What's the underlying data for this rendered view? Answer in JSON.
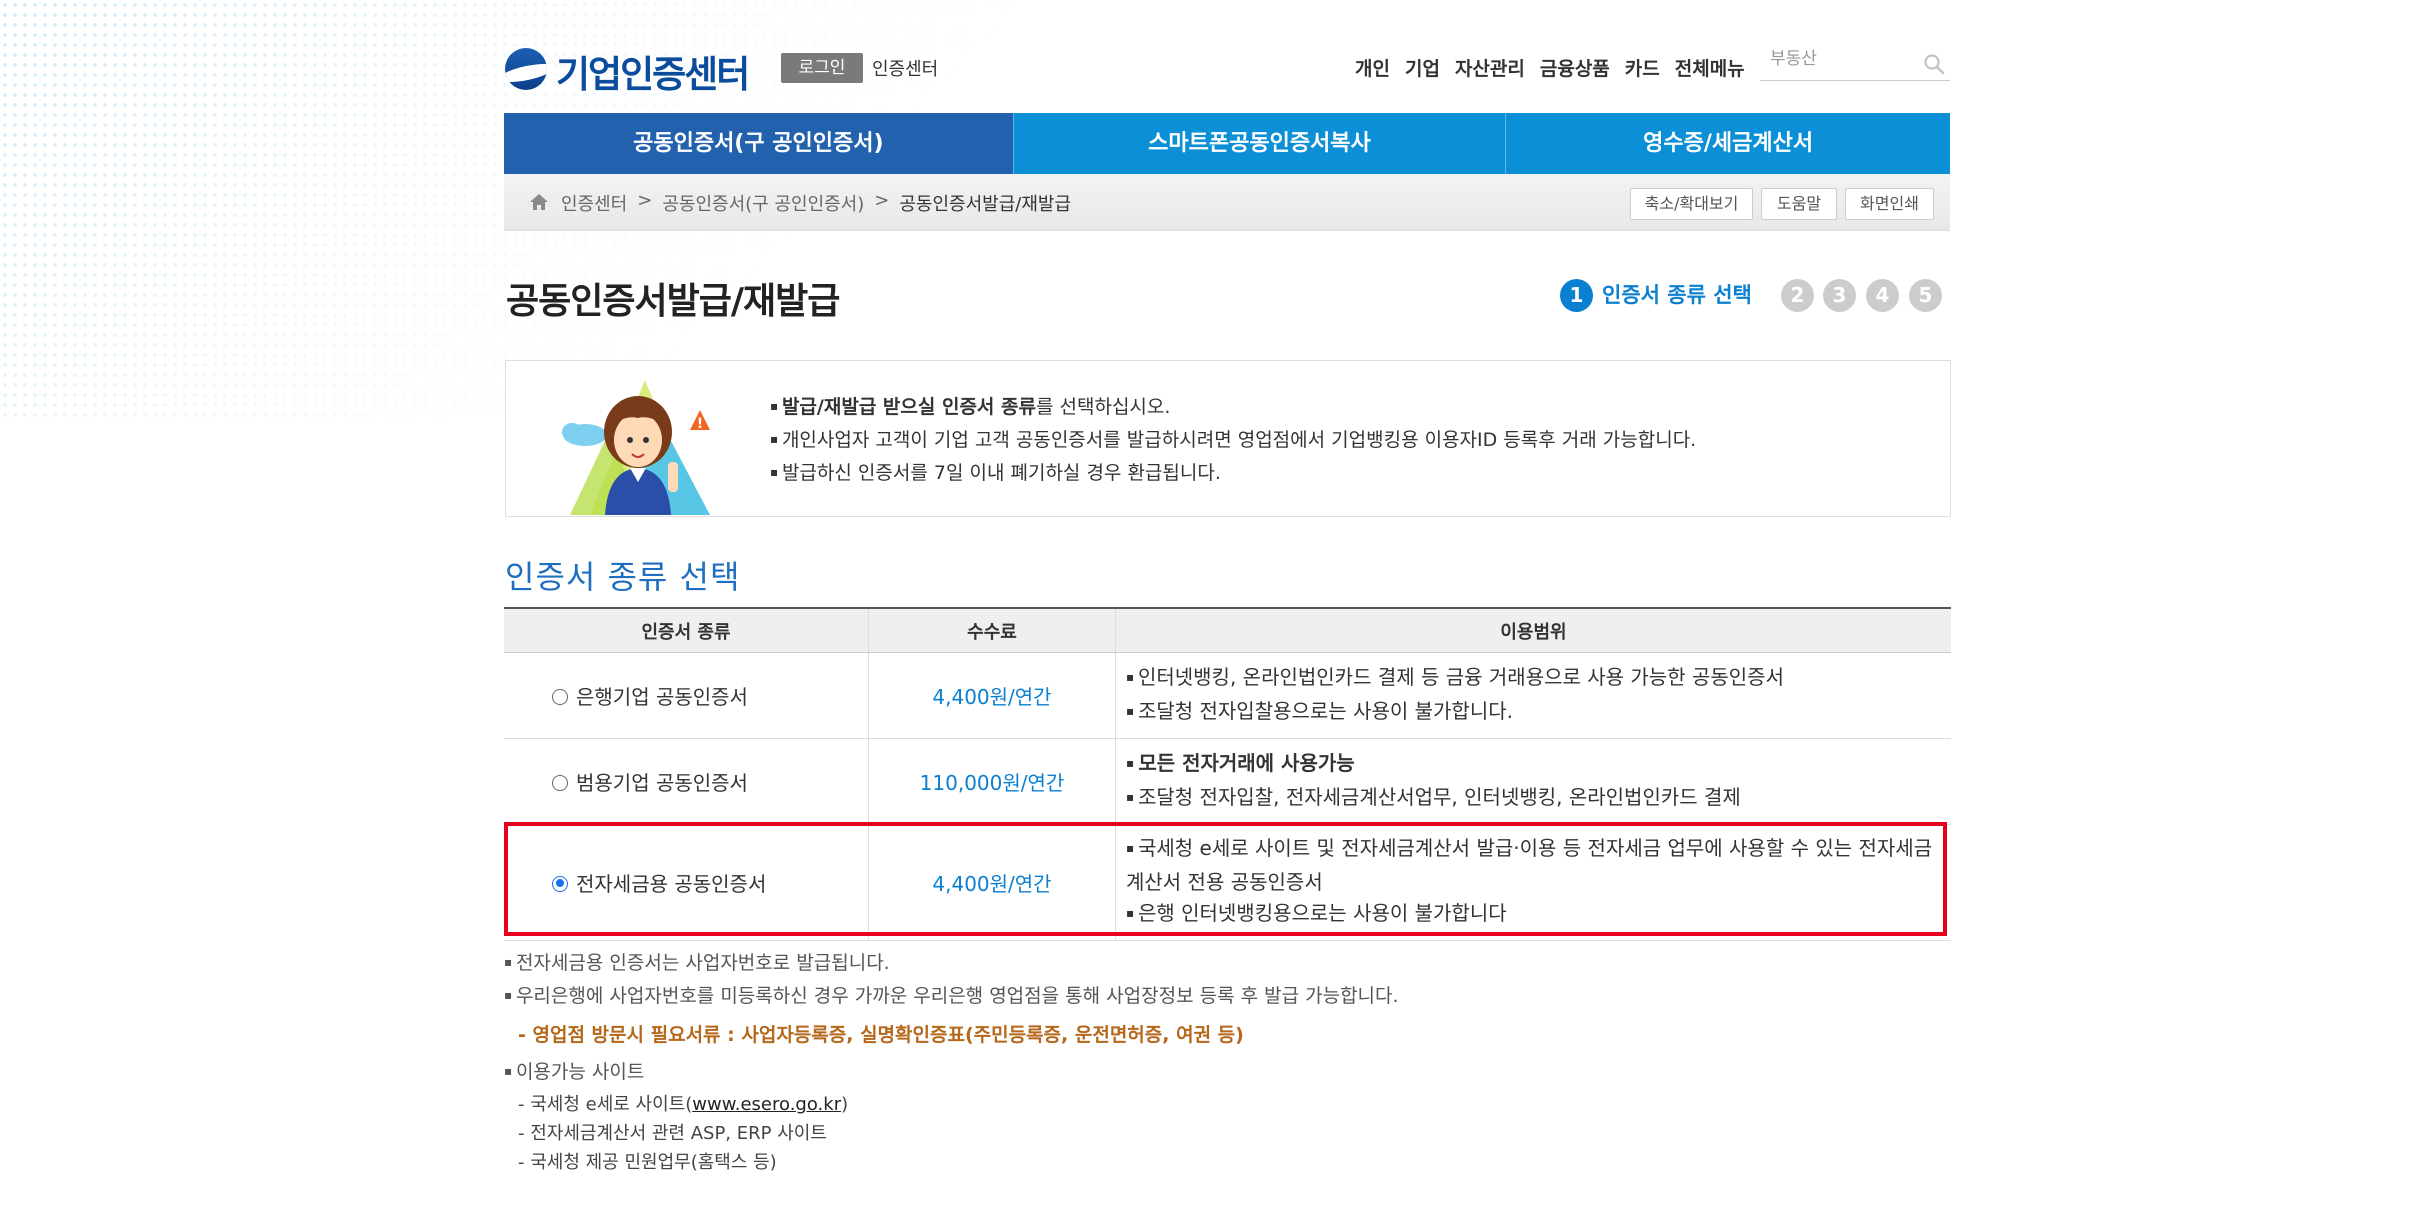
{
  "header": {
    "logo_text": "기업인증센터",
    "login_button": "로그인",
    "cert_center_link": "인증센터",
    "top_nav": [
      "개인",
      "기업",
      "자산관리",
      "금융상품",
      "카드",
      "전체메뉴"
    ],
    "search_placeholder": "부동산"
  },
  "main_nav": {
    "tabs": [
      {
        "label": "공동인증서(구 공인인증서)",
        "active": true
      },
      {
        "label": "스마트폰공동인증서복사",
        "active": false
      },
      {
        "label": "영수증/세금계산서",
        "active": false
      }
    ]
  },
  "breadcrumb": {
    "items": [
      "인증센터",
      "공동인증서(구 공인인증서)",
      "공동인증서발급/재발급"
    ],
    "separator": ">",
    "buttons": [
      "축소/확대보기",
      "도움말",
      "화면인쇄"
    ]
  },
  "page": {
    "title": "공동인증서발급/재발급",
    "steps": [
      "1",
      "2",
      "3",
      "4",
      "5"
    ],
    "active_step_label": "인증서 종류 선택"
  },
  "info": {
    "line1_bold": "발급/재발급 받으실 인증서 종류",
    "line1_rest": "를 선택하십시오.",
    "line2": "개인사업자 고객이 기업 고객 공동인증서를 발급하시려면 영업점에서 기업뱅킹용 이용자ID 등록후 거래 가능합니다.",
    "line3": "발급하신 인증서를 7일 이내 폐기하실 경우 환급됩니다."
  },
  "section_title": "인증서 종류 선택",
  "table": {
    "headers": [
      "인증서 종류",
      "수수료",
      "이용범위"
    ],
    "rows": [
      {
        "type": "은행기업 공동인증서",
        "fee": "4,400원/연간",
        "selected": false,
        "uses": [
          {
            "text": "인터넷뱅킹, 온라인법인카드 결제 등 금융 거래용으로 사용 가능한 공동인증서",
            "bold": false
          },
          {
            "text": "조달청 전자입찰용으로는 사용이 불가합니다.",
            "bold": false
          }
        ]
      },
      {
        "type": "범용기업 공동인증서",
        "fee": "110,000원/연간",
        "selected": false,
        "uses": [
          {
            "text": "모든 전자거래에 사용가능",
            "bold": true
          },
          {
            "text": "조달청 전자입찰, 전자세금계산서업무, 인터넷뱅킹, 온라인법인카드 결제",
            "bold": false
          }
        ]
      },
      {
        "type": "전자세금용 공동인증서",
        "fee": "4,400원/연간",
        "selected": true,
        "uses": [
          {
            "text": "국세청 e세로 사이트 및 전자세금계산서 발급·이용 등 전자세금 업무에 사용할 수 있는 전자세금계산서 전용 공동인증서",
            "bold": false
          },
          {
            "text": "은행 인터넷뱅킹용으로는 사용이 불가합니다",
            "bold": false
          }
        ]
      }
    ]
  },
  "notes": {
    "note1": "전자세금용 인증서는 사업자번호로 발급됩니다.",
    "note2": "우리은행에 사업자번호를 미등록하신 경우 가까운 우리은행 영업점을 통해 사업장정보 등록 후 발급 가능합니다.",
    "required_docs": "- 영업점 방문시 필요서류 : 사업자등록증, 실명확인증표(주민등록증, 운전면허증, 여권 등)",
    "sites_title": "이용가능 사이트",
    "site1_prefix": "- 국세청 e세로 사이트(",
    "site1_link": "www.esero.go.kr",
    "site1_suffix": ")",
    "site2": "- 전자세금계산서 관련 ASP, ERP 사이트",
    "site3": "- 국세청 제공 민원업무(홈택스 등)"
  },
  "colors": {
    "brand_blue": "#0b4d9c",
    "nav_active": "#2261ae",
    "nav_inactive": "#0b8fd6",
    "accent_blue": "#0b7fd0",
    "highlight_red": "#e8001f",
    "note_orange": "#b5671a"
  }
}
